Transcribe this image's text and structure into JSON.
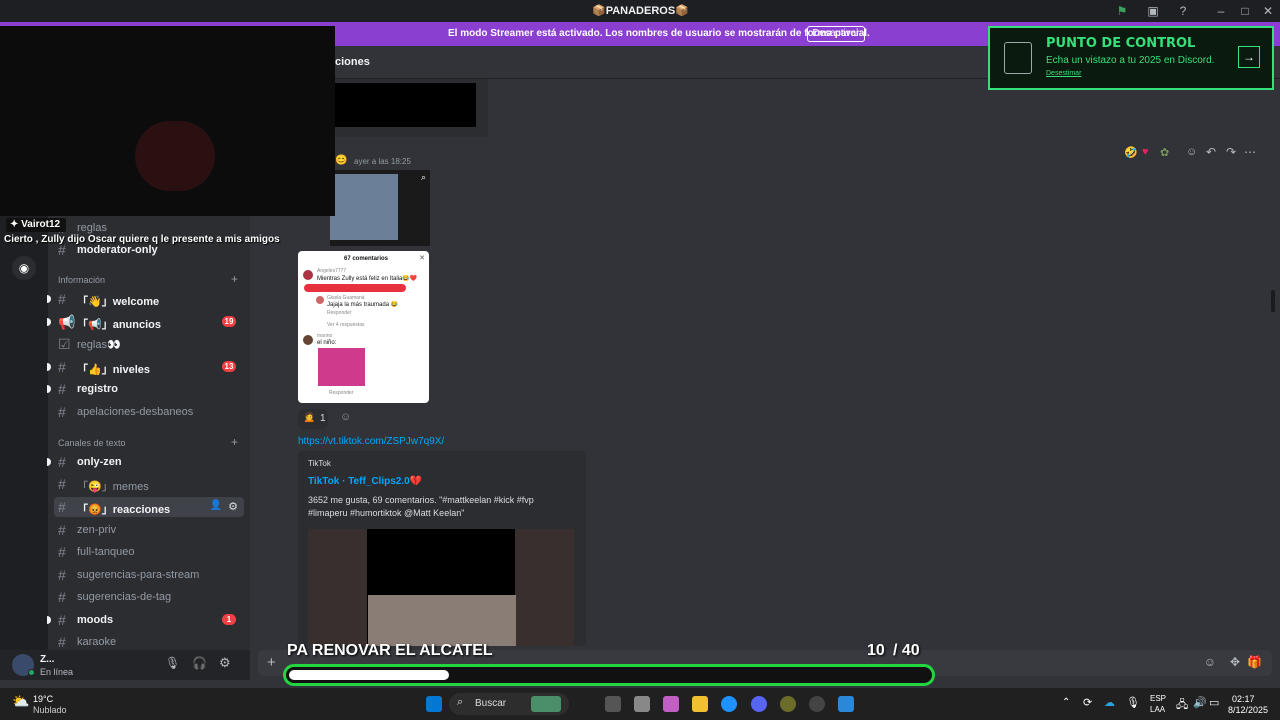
{
  "window": {
    "title": "📦PANADEROS📦"
  },
  "banner": {
    "text": "El modo Streamer está activado. Los nombres de usuario se mostrarán de forma parcial.",
    "button": "Desactivar"
  },
  "overlay": {
    "title": "PUNTO DE CONTROL",
    "subtitle": "Echa un vistazo a tu 2025 en Discord.",
    "dismiss": "Desestimar"
  },
  "webcam_chat": {
    "user": "Vairot12",
    "message": "Cierto , Zully dijo Oscar quiere q le presente a mis amigos"
  },
  "channels": {
    "top_partial": [
      "reglas",
      "moderator-only"
    ],
    "category_info": "Información",
    "info_items": [
      {
        "name": "「👋」welcome",
        "badge": ""
      },
      {
        "name": "「📢」anuncios",
        "badge": "19"
      },
      {
        "name": "reglas👀",
        "badge": ""
      },
      {
        "name": "「👍」niveles",
        "badge": "13"
      },
      {
        "name": "registro",
        "badge": ""
      },
      {
        "name": "apelaciones-desbaneos",
        "badge": ""
      }
    ],
    "category_text": "Canales de texto",
    "text_items": [
      {
        "name": "only-zen",
        "badge": ""
      },
      {
        "name": "「😜」memes",
        "badge": ""
      },
      {
        "name": "「😡」reacciones",
        "badge": ""
      },
      {
        "name": "zen-priv",
        "badge": ""
      },
      {
        "name": "full-tanqueo",
        "badge": ""
      },
      {
        "name": "sugerencias-para-stream",
        "badge": ""
      },
      {
        "name": "sugerencias-de-tag",
        "badge": ""
      },
      {
        "name": "moods",
        "badge": "1"
      },
      {
        "name": "karaoke",
        "badge": ""
      }
    ]
  },
  "user": {
    "name": "Z...",
    "status": "En línea"
  },
  "header": {
    "channel_partial": "ciones"
  },
  "message": {
    "timestamp": "ayer a las 18:25",
    "tiktok_comments_title": "67 comentarios",
    "comment1_user": "Angeles7777",
    "comment1_text": "Mientras Zully está feliz en Italia😂❤️",
    "comment2_user": "Gisela Guamaná",
    "comment2_text": "Jajaja la más traumada 😂",
    "reply_label": "Responder",
    "view_replies": "Ver 4 respuestas",
    "comment3_user": "marino",
    "comment3_text": "el niño:",
    "reaction_count": "1",
    "link": "https://vt.tiktok.com/ZSPJw7q9X/",
    "embed_provider": "TikTok",
    "embed_title": "TikTok · Teff_Clips2.0💔",
    "embed_desc_1": "3652 me gusta, 69 comentarios. \"#mattkeelan #kick #fvp",
    "embed_desc_2": "#limaperu #humortiktok @Matt Keelan\""
  },
  "stream_overlay": {
    "goal_text": "PA RENOVAR EL ALCATEL",
    "goal_current": "10",
    "goal_total": "/ 40",
    "goal_progress": 0.25
  },
  "taskbar": {
    "weather_temp": "19°C",
    "weather_desc": "Nublado",
    "search": "Buscar",
    "lang1": "ESP",
    "lang2": "LAA",
    "time": "02:17",
    "date": "8/12/2025"
  }
}
